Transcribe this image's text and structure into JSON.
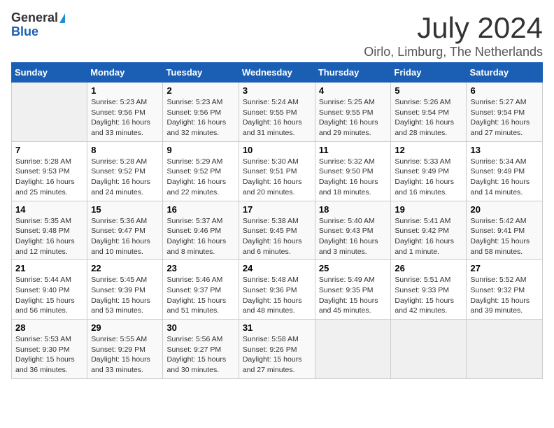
{
  "header": {
    "logo_general": "General",
    "logo_blue": "Blue",
    "month_title": "July 2024",
    "location": "Oirlo, Limburg, The Netherlands"
  },
  "days_of_week": [
    "Sunday",
    "Monday",
    "Tuesday",
    "Wednesday",
    "Thursday",
    "Friday",
    "Saturday"
  ],
  "weeks": [
    [
      {
        "day": "",
        "info": ""
      },
      {
        "day": "1",
        "info": "Sunrise: 5:23 AM\nSunset: 9:56 PM\nDaylight: 16 hours\nand 33 minutes."
      },
      {
        "day": "2",
        "info": "Sunrise: 5:23 AM\nSunset: 9:56 PM\nDaylight: 16 hours\nand 32 minutes."
      },
      {
        "day": "3",
        "info": "Sunrise: 5:24 AM\nSunset: 9:55 PM\nDaylight: 16 hours\nand 31 minutes."
      },
      {
        "day": "4",
        "info": "Sunrise: 5:25 AM\nSunset: 9:55 PM\nDaylight: 16 hours\nand 29 minutes."
      },
      {
        "day": "5",
        "info": "Sunrise: 5:26 AM\nSunset: 9:54 PM\nDaylight: 16 hours\nand 28 minutes."
      },
      {
        "day": "6",
        "info": "Sunrise: 5:27 AM\nSunset: 9:54 PM\nDaylight: 16 hours\nand 27 minutes."
      }
    ],
    [
      {
        "day": "7",
        "info": "Sunrise: 5:28 AM\nSunset: 9:53 PM\nDaylight: 16 hours\nand 25 minutes."
      },
      {
        "day": "8",
        "info": "Sunrise: 5:28 AM\nSunset: 9:52 PM\nDaylight: 16 hours\nand 24 minutes."
      },
      {
        "day": "9",
        "info": "Sunrise: 5:29 AM\nSunset: 9:52 PM\nDaylight: 16 hours\nand 22 minutes."
      },
      {
        "day": "10",
        "info": "Sunrise: 5:30 AM\nSunset: 9:51 PM\nDaylight: 16 hours\nand 20 minutes."
      },
      {
        "day": "11",
        "info": "Sunrise: 5:32 AM\nSunset: 9:50 PM\nDaylight: 16 hours\nand 18 minutes."
      },
      {
        "day": "12",
        "info": "Sunrise: 5:33 AM\nSunset: 9:49 PM\nDaylight: 16 hours\nand 16 minutes."
      },
      {
        "day": "13",
        "info": "Sunrise: 5:34 AM\nSunset: 9:49 PM\nDaylight: 16 hours\nand 14 minutes."
      }
    ],
    [
      {
        "day": "14",
        "info": "Sunrise: 5:35 AM\nSunset: 9:48 PM\nDaylight: 16 hours\nand 12 minutes."
      },
      {
        "day": "15",
        "info": "Sunrise: 5:36 AM\nSunset: 9:47 PM\nDaylight: 16 hours\nand 10 minutes."
      },
      {
        "day": "16",
        "info": "Sunrise: 5:37 AM\nSunset: 9:46 PM\nDaylight: 16 hours\nand 8 minutes."
      },
      {
        "day": "17",
        "info": "Sunrise: 5:38 AM\nSunset: 9:45 PM\nDaylight: 16 hours\nand 6 minutes."
      },
      {
        "day": "18",
        "info": "Sunrise: 5:40 AM\nSunset: 9:43 PM\nDaylight: 16 hours\nand 3 minutes."
      },
      {
        "day": "19",
        "info": "Sunrise: 5:41 AM\nSunset: 9:42 PM\nDaylight: 16 hours\nand 1 minute."
      },
      {
        "day": "20",
        "info": "Sunrise: 5:42 AM\nSunset: 9:41 PM\nDaylight: 15 hours\nand 58 minutes."
      }
    ],
    [
      {
        "day": "21",
        "info": "Sunrise: 5:44 AM\nSunset: 9:40 PM\nDaylight: 15 hours\nand 56 minutes."
      },
      {
        "day": "22",
        "info": "Sunrise: 5:45 AM\nSunset: 9:39 PM\nDaylight: 15 hours\nand 53 minutes."
      },
      {
        "day": "23",
        "info": "Sunrise: 5:46 AM\nSunset: 9:37 PM\nDaylight: 15 hours\nand 51 minutes."
      },
      {
        "day": "24",
        "info": "Sunrise: 5:48 AM\nSunset: 9:36 PM\nDaylight: 15 hours\nand 48 minutes."
      },
      {
        "day": "25",
        "info": "Sunrise: 5:49 AM\nSunset: 9:35 PM\nDaylight: 15 hours\nand 45 minutes."
      },
      {
        "day": "26",
        "info": "Sunrise: 5:51 AM\nSunset: 9:33 PM\nDaylight: 15 hours\nand 42 minutes."
      },
      {
        "day": "27",
        "info": "Sunrise: 5:52 AM\nSunset: 9:32 PM\nDaylight: 15 hours\nand 39 minutes."
      }
    ],
    [
      {
        "day": "28",
        "info": "Sunrise: 5:53 AM\nSunset: 9:30 PM\nDaylight: 15 hours\nand 36 minutes."
      },
      {
        "day": "29",
        "info": "Sunrise: 5:55 AM\nSunset: 9:29 PM\nDaylight: 15 hours\nand 33 minutes."
      },
      {
        "day": "30",
        "info": "Sunrise: 5:56 AM\nSunset: 9:27 PM\nDaylight: 15 hours\nand 30 minutes."
      },
      {
        "day": "31",
        "info": "Sunrise: 5:58 AM\nSunset: 9:26 PM\nDaylight: 15 hours\nand 27 minutes."
      },
      {
        "day": "",
        "info": ""
      },
      {
        "day": "",
        "info": ""
      },
      {
        "day": "",
        "info": ""
      }
    ]
  ]
}
